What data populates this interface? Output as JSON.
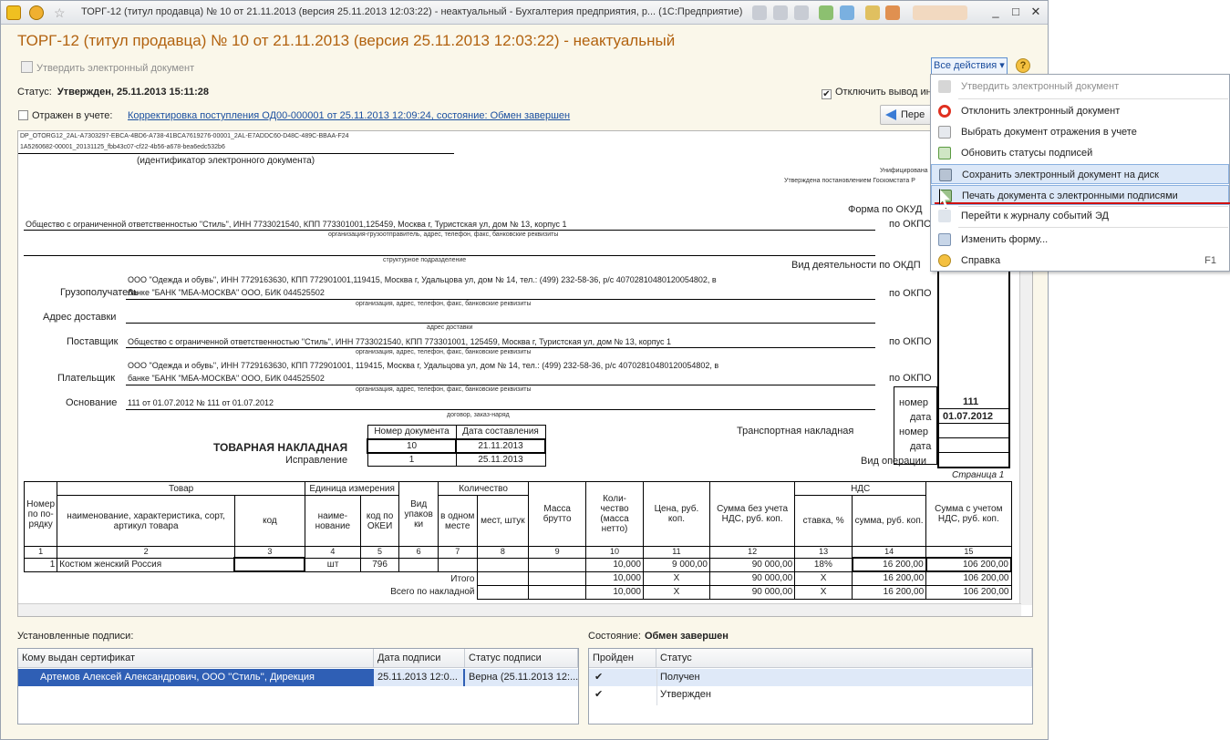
{
  "window": {
    "title": "ТОРГ-12 (титул продавца) № 10 от 21.11.2013 (версия 25.11.2013 12:03:22) - неактуальный - Бухгалтерия предприятия, р... (1С:Предприятие)",
    "minimize": "_",
    "maximize": "□",
    "close": "✕"
  },
  "header": {
    "title": "ТОРГ-12 (титул продавца) № 10 от 21.11.2013 (версия 25.11.2013 12:03:22) - неактуальный",
    "approve": "Утвердить электронный документ",
    "all_actions": "Все действия ▾",
    "help": "?"
  },
  "status": {
    "label": "Статус:",
    "value": "Утвержден, 25.11.2013 15:11:28",
    "disable_output": "Отключить вывод ин",
    "reflected": "Отражен в учете:",
    "correction_link": "Корректировка поступления ОД00-000001 от 25.11.2013 12:09:24, состояние: Обмен завершен",
    "go_button": "Пере"
  },
  "doc": {
    "id1": "DP_OTORG12_2AL-A7303297-EBCA-4BD6-A738-41BCA7619276-00001_2AL-E7ADDC60-D48C-489C-BBAA-F24",
    "id2": "1A5260682-00001_20131125_fbb43c07-cf22-4b56-a678-bea6edc532b6",
    "id_caption": "(идентификатор электронного документа)",
    "unified": "Унифицирована",
    "approved_by": "Утверждена постановлением Госкомстата Р",
    "form_okud": "Форма по ОКУД",
    "okpo": "по ОКПО",
    "activity": "Вид деятельности по ОКДП",
    "org": "Общество с ограниченной ответственностью \"Стиль\", ИНН 7733021540, КПП 773301001,125459, Москва г, Туристская ул, дом № 13, корпус 1",
    "org_caption": "организация-грузоотправитель, адрес, телефон, факс, банковские реквизиты",
    "struct_caption": "структурное подразделение",
    "consignee_label": "Грузополучатель",
    "consignee1": "ООО \"Одежда и обувь\", ИНН 7729163630, КПП 772901001,119415, Москва г, Удальцова ул, дом № 14, тел.: (499) 232-58-36, р/с 40702810480120054802, в",
    "consignee2": "банке \"БАНК \"МБА-МОСКВА\" ООО, БИК 044525502",
    "org_caption2": "организация, адрес, телефон, факс, банковские реквизиты",
    "delivery_label": "Адрес доставки",
    "delivery_caption": "адрес доставки",
    "supplier_label": "Поставщик",
    "supplier": "Общество с ограниченной ответственностью \"Стиль\", ИНН 7733021540, КПП 773301001, 125459, Москва г, Туристская ул, дом № 13, корпус 1",
    "payer_label": "Плательщик",
    "payer1": "ООО \"Одежда и обувь\", ИНН 7729163630, КПП 772901001, 119415, Москва г, Удальцова ул, дом № 14, тел.: (499) 232-58-36, р/с 40702810480120054802, в",
    "payer2": "банке \"БАНК \"МБА-МОСКВА\" ООО, БИК 044525502",
    "basis_label": "Основание",
    "basis": "111 от 01.07.2012 № 111 от 01.07.2012",
    "basis_caption": "договор, заказ-наряд",
    "number_label": "номер",
    "number_value": "111",
    "date_label": "дата",
    "date_value": "01.07.2012",
    "transport": "Транспортная накладная",
    "number2": "номер",
    "date2": "дата",
    "operation": "Вид операции",
    "waybill": "ТОВАРНАЯ НАКЛАДНАЯ",
    "correction": "Исправление",
    "doc_num_hdr": "Номер документа",
    "doc_date_hdr": "Дата составления",
    "doc_num": "10",
    "doc_date": "21.11.2013",
    "corr_num": "1",
    "corr_date": "25.11.2013",
    "page": "Страница 1"
  },
  "table": {
    "h_num": "Номер по по- рядку",
    "h_goods": "Товар",
    "h_unit": "Единица измерения",
    "h_pack": "Вид упаков ки",
    "h_qty": "Количество",
    "h_mass": "Масса брутто",
    "h_qtynet": "Коли- чество (масса нетто)",
    "h_price": "Цена, руб. коп.",
    "h_sumnov": "Сумма без учета НДС, руб. коп.",
    "h_vat": "НДС",
    "h_sumvat": "Сумма с учетом НДС, руб. коп.",
    "s_name": "наименование, характеристика, сорт, артикул товара",
    "s_code": "код",
    "s_uname": "наиме- нование",
    "s_okei": "код по ОКЕИ",
    "s_one": "в одном месте",
    "s_places": "мест, штук",
    "s_rate": "ставка, %",
    "s_vatsum": "сумма, руб. коп.",
    "nums": [
      "1",
      "2",
      "3",
      "4",
      "5",
      "6",
      "7",
      "8",
      "9",
      "10",
      "11",
      "12",
      "13",
      "14",
      "15"
    ],
    "row": {
      "n": "1",
      "name": "Костюм женский Россия",
      "unit": "шт",
      "okei": "796",
      "qty": "10,000",
      "price": "9 000,00",
      "sum": "90 000,00",
      "rate": "18%",
      "vat": "16 200,00",
      "total": "106 200,00"
    },
    "itogo": {
      "label": "Итого",
      "qty": "10,000",
      "price": "X",
      "sum": "90 000,00",
      "rate": "X",
      "vat": "16 200,00",
      "total": "106 200,00"
    },
    "vsego": {
      "label": "Всего по накладной",
      "qty": "10,000",
      "price": "X",
      "sum": "90 000,00",
      "rate": "X",
      "vat": "16 200,00",
      "total": "106 200,00"
    }
  },
  "signatures": {
    "label": "Установленные подписи:",
    "h_issued": "Кому выдан сертификат",
    "h_date": "Дата подписи",
    "h_status": "Статус подписи",
    "row": {
      "issued": "Артемов Алексей Александрович, ООО ''Стиль'', Дирекция",
      "date": "25.11.2013 12:0...",
      "status": "Верна (25.11.2013 12:..."
    }
  },
  "state": {
    "label": "Состояние:",
    "value": "Обмен завершен",
    "h_passed": "Пройден",
    "h_status": "Статус",
    "rows": [
      {
        "check": "✔",
        "status": "Получен"
      },
      {
        "check": "✔",
        "status": "Утвержден"
      }
    ]
  },
  "menu": {
    "items": [
      "Утвердить электронный документ",
      "Отклонить электронный документ",
      "Выбрать документ отражения в учете",
      "Обновить статусы подписей",
      "Сохранить электронный документ на диск",
      "Печать документа с электронными подписями",
      "Перейти к журналу событий ЭД",
      "Изменить форму...",
      "Справка"
    ],
    "help_key": "F1"
  }
}
